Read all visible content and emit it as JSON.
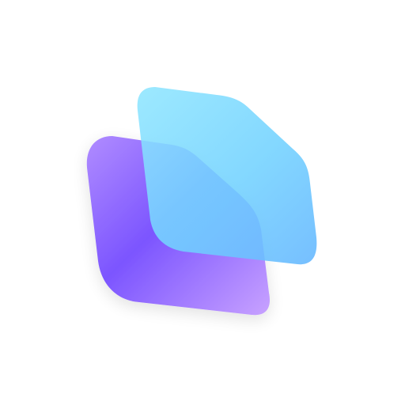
{
  "icon": {
    "name": "overlapping-rounded-parallelograms-logo",
    "colors": {
      "background": "#ffffff",
      "back_shape_gradient": [
        "#9b6cff",
        "#7b55ff",
        "#c79cff"
      ],
      "front_shape_gradient": [
        "#8fe6ff",
        "#6fd3ff",
        "#5bbcff"
      ],
      "overlap_tint": "#5aa6ff"
    }
  }
}
